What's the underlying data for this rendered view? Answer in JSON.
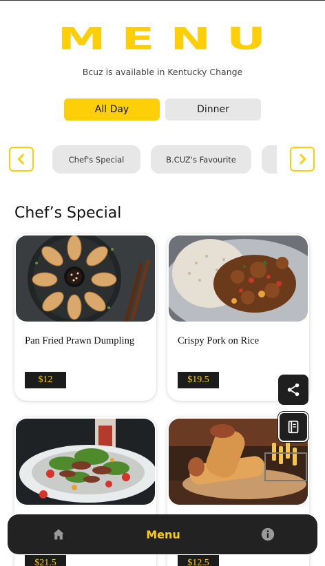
{
  "header": {
    "logo_text": "MENU",
    "subtitle": "Bcuz is available in Kentucky Change"
  },
  "meal_tabs": [
    {
      "label": "All Day",
      "active": true
    },
    {
      "label": "Dinner",
      "active": false
    }
  ],
  "categories": [
    {
      "label": "Chef's Special"
    },
    {
      "label": "B.CUZ's Favourite"
    },
    {
      "label": ""
    }
  ],
  "section": {
    "title": "Chef’s Special"
  },
  "items": [
    {
      "name": "Pan Fried Prawn Dumpling",
      "price": "$12",
      "image": "dumplings-photo"
    },
    {
      "name": "Crispy Pork on Rice",
      "price": "$19.5",
      "image": "pork-rice-photo"
    },
    {
      "name": "",
      "price": "$21.5",
      "image": "beef-salad-photo"
    },
    {
      "name": "",
      "price": "$12.5",
      "image": "wrap-photo"
    }
  ],
  "floating_actions": [
    {
      "icon": "share-icon"
    },
    {
      "icon": "menu-book-icon"
    }
  ],
  "bottom_nav": {
    "home_icon": "home-icon",
    "center_label": "Menu",
    "info_icon": "info-icon"
  },
  "colors": {
    "accent": "#fccf08",
    "pill_bg": "#e7e7e7",
    "dark": "#222222"
  }
}
